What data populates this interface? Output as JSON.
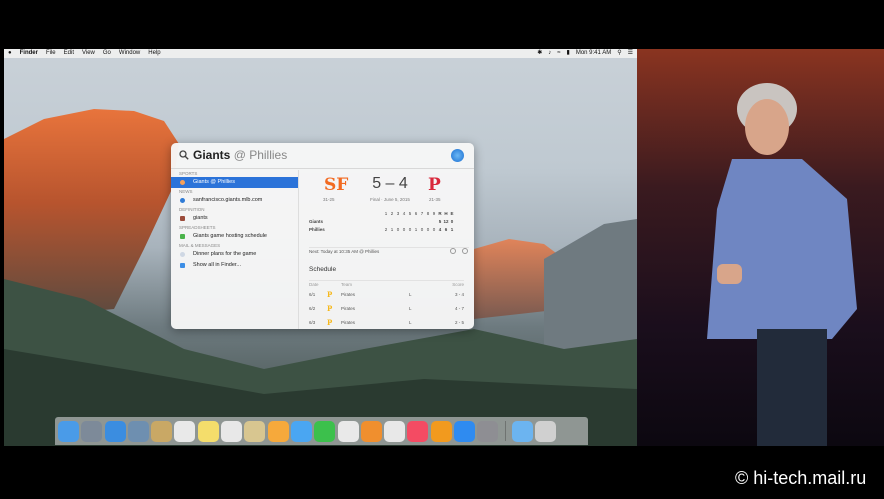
{
  "menubar": {
    "apple": "",
    "items": [
      "Finder",
      "File",
      "Edit",
      "View",
      "Go",
      "Window",
      "Help"
    ],
    "clock": "Mon 9:41 AM"
  },
  "spotlight": {
    "query_main": "Giants",
    "query_rest": "@ Phillies",
    "categories": {
      "sports": "Sports",
      "news": "News",
      "definition": "Definition",
      "spreadsheets": "Spreadsheets",
      "mail": "Mail & Messages"
    },
    "results": {
      "sports": "Giants @ Phillies",
      "news": "sanfrancisco.giants.mlb.com",
      "definition": "giants",
      "spreadsheets": "Giants game hosting schedule",
      "mail": "Dinner plans for the game",
      "show_all": "Show all in Finder..."
    },
    "preview": {
      "home_logo": "SF",
      "away_logo": "P",
      "home_record": "31-25",
      "away_record": "21-35",
      "score": "5 – 4",
      "final": "Final · June 5, 2015",
      "innings": [
        "1",
        "2",
        "3",
        "4",
        "5",
        "6",
        "7",
        "8",
        "9",
        "R",
        "H",
        "E"
      ],
      "line": [
        {
          "team": "Giants",
          "cells": [
            "",
            "",
            "",
            "",
            "",
            "",
            "",
            "",
            "",
            "5",
            "12",
            "0"
          ]
        },
        {
          "team": "Phillies",
          "cells": [
            "2",
            "1",
            "0",
            "0",
            "0",
            "1",
            "0",
            "0",
            "0",
            "4",
            "6",
            "1"
          ]
        }
      ],
      "next": "Next: Today at 10:35 AM @ Phillies",
      "schedule_title": "Schedule",
      "schedule_head": {
        "date": "Date",
        "team": "Team",
        "score": "Score"
      },
      "schedule": [
        {
          "date": "6/1",
          "logo": "P",
          "team": "Pirates",
          "res": "L",
          "score": "3 - 4"
        },
        {
          "date": "6/2",
          "logo": "P",
          "team": "Pirates",
          "res": "L",
          "score": "4 - 7"
        },
        {
          "date": "6/3",
          "logo": "P",
          "team": "Pirates",
          "res": "L",
          "score": "2 - 5"
        }
      ]
    }
  },
  "dock": {
    "colors": [
      "#4a9be8",
      "#7d8a99",
      "#3b8de0",
      "#6e8fb0",
      "#c9a865",
      "#e9e9e9",
      "#f4dd6b",
      "#e8e8e8",
      "#d8c690",
      "#f6a93b",
      "#4aa6f2",
      "#3cc04c",
      "#e9e9e9",
      "#f08f2e",
      "#e8e8e8",
      "#f44b63",
      "#f29a1e",
      "#2f8bf0",
      "#8e8e93"
    ],
    "after_sep_colors": [
      "#6cb4f0",
      "#d0d0d0"
    ],
    "icons": [
      "finder-icon",
      "launchpad-icon",
      "safari-icon",
      "mail-icon",
      "contacts-icon",
      "calendar-icon",
      "notes-icon",
      "reminders-icon",
      "preview-icon",
      "photos-icon",
      "messages-icon",
      "facetime-icon",
      "pages-icon",
      "numbers-icon",
      "keynote-icon",
      "itunes-icon",
      "ibooks-icon",
      "app-store-icon",
      "system-preferences-icon"
    ],
    "after_sep_icons": [
      "downloads-folder-icon",
      "trash-icon"
    ]
  },
  "watermark": "© hi-tech.mail.ru"
}
